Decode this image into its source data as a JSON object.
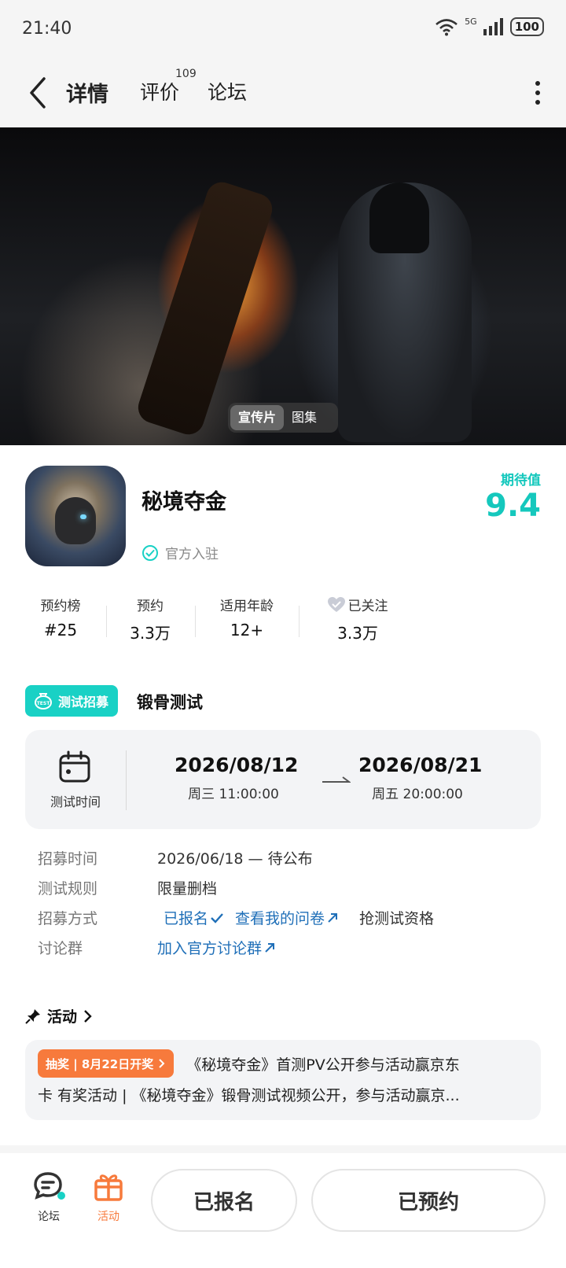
{
  "status": {
    "time": "21:40",
    "network": "5G",
    "battery": "100"
  },
  "header": {
    "tabs": [
      "详情",
      "评价",
      "论坛"
    ],
    "review_count": "109"
  },
  "banner": {
    "media_tabs": [
      "宣传片",
      "图集"
    ]
  },
  "app": {
    "name": "秘境夺金",
    "official_label": "官方入驻",
    "expect_label": "期待值",
    "expect_score": "9.4"
  },
  "stats": [
    {
      "label": "预约榜",
      "value": "#25"
    },
    {
      "label": "预约",
      "value": "3.3万"
    },
    {
      "label": "适用年龄",
      "value": "12+"
    },
    {
      "label": "已关注",
      "value": "3.3万"
    }
  ],
  "recruit": {
    "badge": "测试招募",
    "title": "锻骨测试",
    "time_label": "测试时间",
    "start": {
      "date": "2026/08/12",
      "weekday_time": "周三  11:00:00"
    },
    "end": {
      "date": "2026/08/21",
      "weekday_time": "周五  20:00:00"
    },
    "rows": {
      "recruit_time_key": "招募时间",
      "recruit_time_val": "2026/06/18 — 待公布",
      "rules_key": "测试规则",
      "rules_val": "限量删档",
      "method_key": "招募方式",
      "signed_up": "已报名",
      "questionnaire": "查看我的问卷",
      "grab": "抢测试资格",
      "group_key": "讨论群",
      "group_val": "加入官方讨论群"
    }
  },
  "activity": {
    "title": "活动",
    "tag": "抽奖 | 8月22日开奖",
    "line1": "《秘境夺金》首测PV公开参与活动赢京东",
    "line2": "卡 有奖活动 | 《秘境夺金》锻骨测试视频公开，参与活动赢京..."
  },
  "bottom": {
    "forum_label": "论坛",
    "activity_label": "活动",
    "signed_button": "已报名",
    "reserved_button": "已预约"
  },
  "colors": {
    "accent": "#19d1c5",
    "orange": "#f77a3c",
    "link": "#1f6fb8"
  }
}
